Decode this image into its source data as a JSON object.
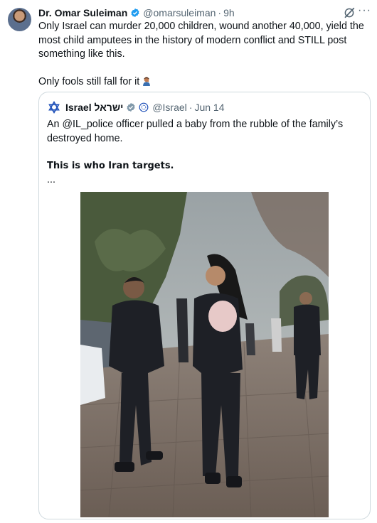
{
  "tweet": {
    "display_name": "Dr. Omar Suleiman",
    "handle": "@omarsuleiman",
    "separator": "·",
    "time": "9h",
    "text_line1": "Only Israel can murder 20,000 children, wound another 40,000, yield the most child amputees in the history of modern conflict and STILL post something like this.",
    "text_line2": "Only fools still fall for it",
    "emoji_icon": "person-facepalming-icon",
    "grok_icon": "grok-icon",
    "more_label": "···"
  },
  "quoted": {
    "display_name": "Israel ישראל",
    "handle": "@Israel",
    "separator": "·",
    "date": "Jun 14",
    "text_line1": "An @IL_police officer pulled a baby from the rubble of the family’s destroyed home.",
    "text_line2": "This is who Iran targets.",
    "text_line3": "...",
    "avatar_icon": "star-of-david-icon",
    "badge_icon": "government-seal-icon",
    "image_alt": "police-officers-street-photo"
  },
  "colors": {
    "verified_blue": "#1d9bf0",
    "verified_gray": "#829aab",
    "muted_text": "#536471",
    "border": "#cfd9de"
  }
}
